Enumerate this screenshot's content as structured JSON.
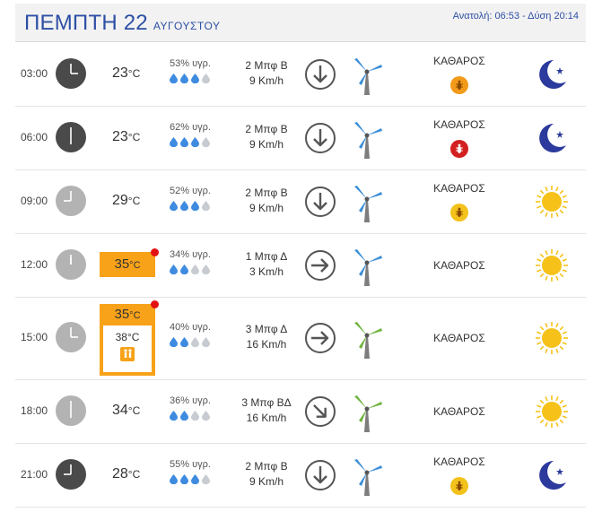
{
  "header": {
    "day": "ΠΕΜΠΤΗ 22",
    "month": "ΑΥΓΟΥΣΤΟΥ",
    "sun_times": "Ανατολή: 06:53 - Δύση 20:14"
  },
  "colors": {
    "title": "#2d4fa5",
    "heat": "#f7a219",
    "alert_dot": "#e31212",
    "drop_blue": "#3e8be0",
    "drop_empty": "#c8ccd2",
    "moon": "#2b3a9c",
    "sun": "#f6c21a",
    "turbine_blue": "#3a8ed8",
    "turbine_green": "#6fb33e"
  },
  "rows": [
    {
      "time": "03:00",
      "clock": "dark",
      "temp": "23",
      "unit": "°C",
      "heat": false,
      "feels": "",
      "humidity": "53% υγρ.",
      "drops": 3,
      "wind_force": "2 Μπφ Β",
      "wind_speed": "9 Km/h",
      "wind_dir": "down",
      "turbine": "blue",
      "condition": "ΚΑΘΑΡΟΣ",
      "insect": "orange",
      "weather": "moon"
    },
    {
      "time": "06:00",
      "clock": "dark",
      "temp": "23",
      "unit": "°C",
      "heat": false,
      "feels": "",
      "humidity": "62% υγρ.",
      "drops": 3,
      "wind_force": "2 Μπφ Β",
      "wind_speed": "9 Km/h",
      "wind_dir": "down",
      "turbine": "blue",
      "condition": "ΚΑΘΑΡΟΣ",
      "insect": "red",
      "weather": "moon"
    },
    {
      "time": "09:00",
      "clock": "light",
      "temp": "29",
      "unit": "°C",
      "heat": false,
      "feels": "",
      "humidity": "52% υγρ.",
      "drops": 3,
      "wind_force": "2 Μπφ Β",
      "wind_speed": "9 Km/h",
      "wind_dir": "down",
      "turbine": "blue",
      "condition": "ΚΑΘΑΡΟΣ",
      "insect": "yellow",
      "weather": "sun"
    },
    {
      "time": "12:00",
      "clock": "light",
      "temp": "35",
      "unit": "°C",
      "heat": true,
      "feels": "",
      "humidity": "34% υγρ.",
      "drops": 2,
      "wind_force": "1 Μπφ Δ",
      "wind_speed": "3 Km/h",
      "wind_dir": "right",
      "turbine": "blue",
      "condition": "ΚΑΘΑΡΟΣ",
      "insect": "",
      "weather": "sun"
    },
    {
      "time": "15:00",
      "clock": "light",
      "temp": "35",
      "unit": "°C",
      "heat": true,
      "feels": "38°C",
      "humidity": "40% υγρ.",
      "drops": 2,
      "wind_force": "3 Μπφ Δ",
      "wind_speed": "16 Km/h",
      "wind_dir": "right",
      "turbine": "green",
      "condition": "ΚΑΘΑΡΟΣ",
      "insect": "",
      "weather": "sun"
    },
    {
      "time": "18:00",
      "clock": "light",
      "temp": "34",
      "unit": "°C",
      "heat": false,
      "feels": "",
      "humidity": "36% υγρ.",
      "drops": 2,
      "wind_force": "3 Μπφ ΒΔ",
      "wind_speed": "16 Km/h",
      "wind_dir": "down-right",
      "turbine": "green",
      "condition": "ΚΑΘΑΡΟΣ",
      "insect": "",
      "weather": "sun"
    },
    {
      "time": "21:00",
      "clock": "dark",
      "temp": "28",
      "unit": "°C",
      "heat": false,
      "feels": "",
      "humidity": "55% υγρ.",
      "drops": 3,
      "wind_force": "2 Μπφ Β",
      "wind_speed": "9 Km/h",
      "wind_dir": "down",
      "turbine": "blue",
      "condition": "ΚΑΘΑΡΟΣ",
      "insect": "yellow",
      "weather": "moon"
    }
  ]
}
